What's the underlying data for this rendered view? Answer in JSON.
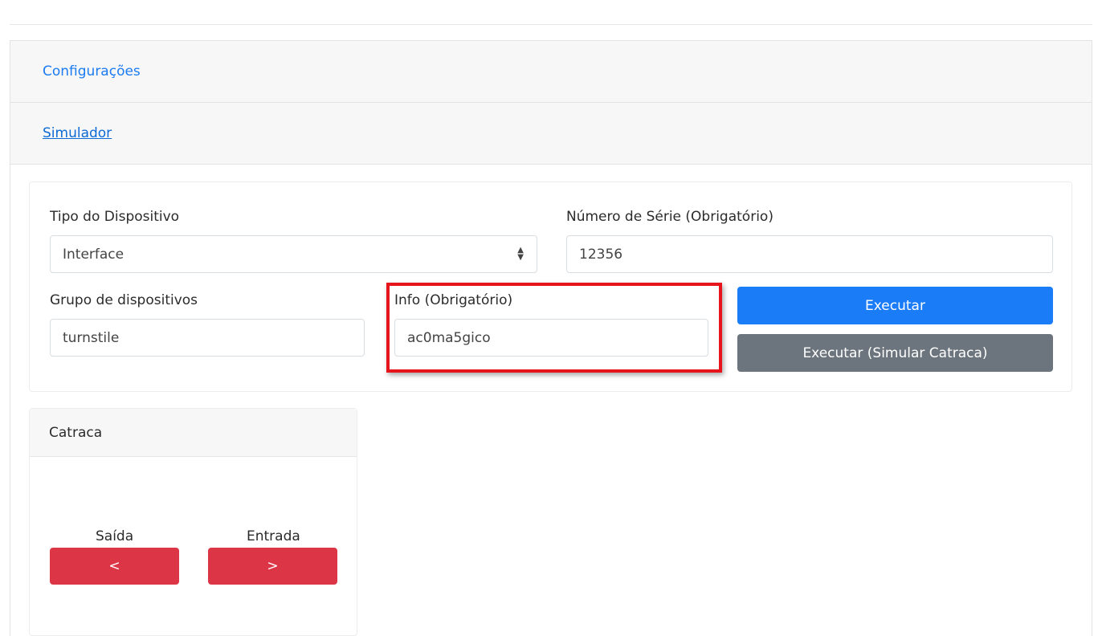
{
  "accordion": {
    "config_label": "Configurações",
    "simulator_label": "Simulador"
  },
  "form": {
    "device_type_label": "Tipo do Dispositivo",
    "device_type_value": "Interface",
    "serial_label": "Número de Série (Obrigatório)",
    "serial_value": "12356",
    "group_label": "Grupo de dispositivos",
    "group_value": "turnstile",
    "info_label": "Info (Obrigatório)",
    "info_value": "ac0ma5gico",
    "execute_label": "Executar",
    "execute_turnstile_label": "Executar (Simular Catraca)"
  },
  "turnstile": {
    "title": "Catraca",
    "exit_label": "Saída",
    "exit_button": "<",
    "entry_label": "Entrada",
    "entry_button": ">"
  },
  "colors": {
    "link": "#1b7bf0",
    "primary": "#1a7cf6",
    "secondary": "#6c757d",
    "danger": "#dc3545",
    "highlight": "#e8141b"
  }
}
